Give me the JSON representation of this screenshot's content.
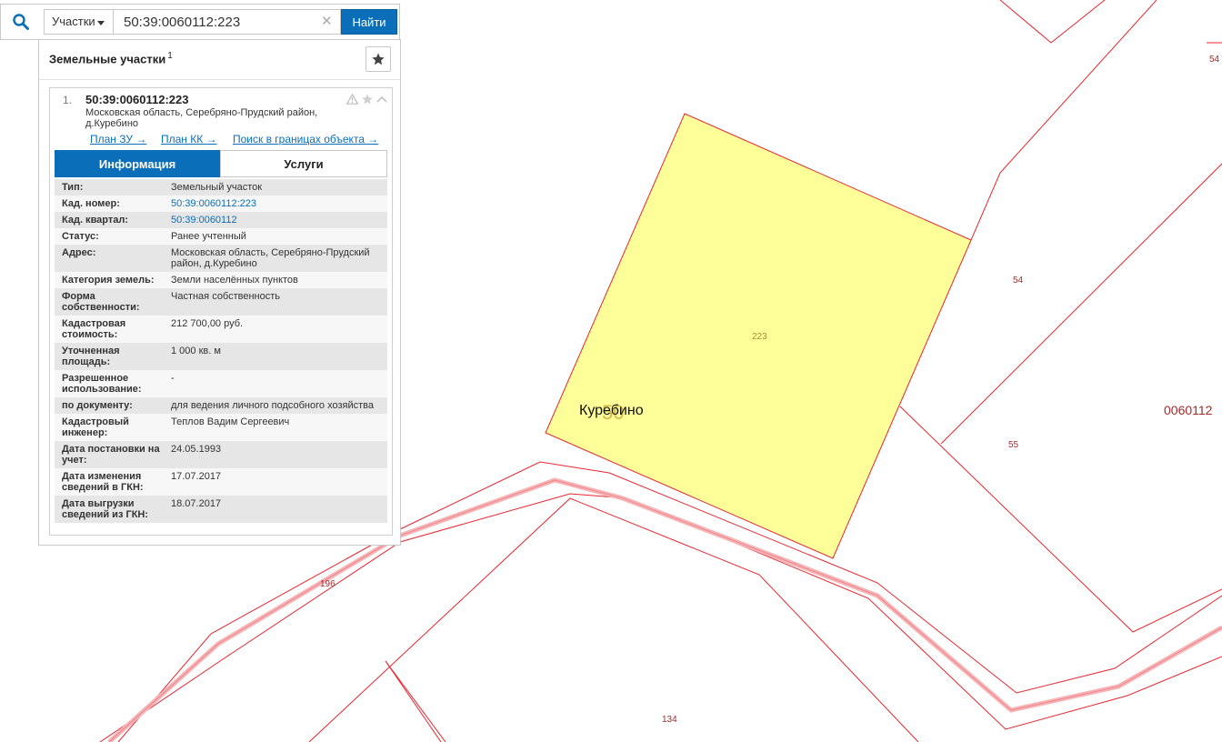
{
  "search": {
    "type_label": "Участки",
    "query": "50:39:0060112:223",
    "submit_label": "Найти"
  },
  "panel": {
    "title": "Земельные участки",
    "count": "1"
  },
  "card": {
    "index": "1.",
    "cad_number": "50:39:0060112:223",
    "address": "Московская область, Серебряно-Прудский район, д.Куребино",
    "links": [
      "План ЗУ →",
      "План КК →",
      "Поиск в границах объекта →"
    ],
    "tabs": [
      "Информация",
      "Услуги"
    ],
    "active_tab": "Информация",
    "info": [
      {
        "label": "Тип:",
        "value": "Земельный участок"
      },
      {
        "label": "Кад. номер:",
        "value": "50:39:0060112:223",
        "link": true
      },
      {
        "label": "Кад. квартал:",
        "value": "50:39:0060112",
        "link": true
      },
      {
        "label": "Статус:",
        "value": "Ранее учтенный"
      },
      {
        "label": "Адрес:",
        "value": "Московская область, Серебряно-Прудский район, д.Куребино"
      },
      {
        "label": "Категория земель:",
        "value": "Земли населённых пунктов"
      },
      {
        "label": "Форма собственности:",
        "value": "Частная собственность"
      },
      {
        "label": "Кадастровая стоимость:",
        "value": "212 700,00 руб."
      },
      {
        "label": "Уточненная площадь:",
        "value": "1 000 кв. м"
      },
      {
        "label": "Разрешенное использование:",
        "value": "-"
      },
      {
        "label": "по документу:",
        "value": "для ведения личного подсобного хозяйства"
      },
      {
        "label": "Кадастровый инженер:",
        "value": "Теплов Вадим Сергеевич"
      },
      {
        "label": "Дата постановки на учет:",
        "value": "24.05.1993"
      },
      {
        "label": "Дата изменения сведений в ГКН:",
        "value": "17.07.2017"
      },
      {
        "label": "Дата выгрузки сведений из ГКН:",
        "value": "18.07.2017"
      }
    ]
  },
  "map": {
    "locality_label": "Куребино",
    "locality_badge": "50",
    "selected_parcel_label": "223",
    "quarter_label": "0060112",
    "parcel_labels": [
      "54",
      "54",
      "55",
      "196",
      "134"
    ],
    "colors": {
      "boundary": "#e8262f",
      "selected_fill": "#ffff99",
      "road_fill": "#f6b3b6",
      "label": "#a32a2a"
    }
  }
}
